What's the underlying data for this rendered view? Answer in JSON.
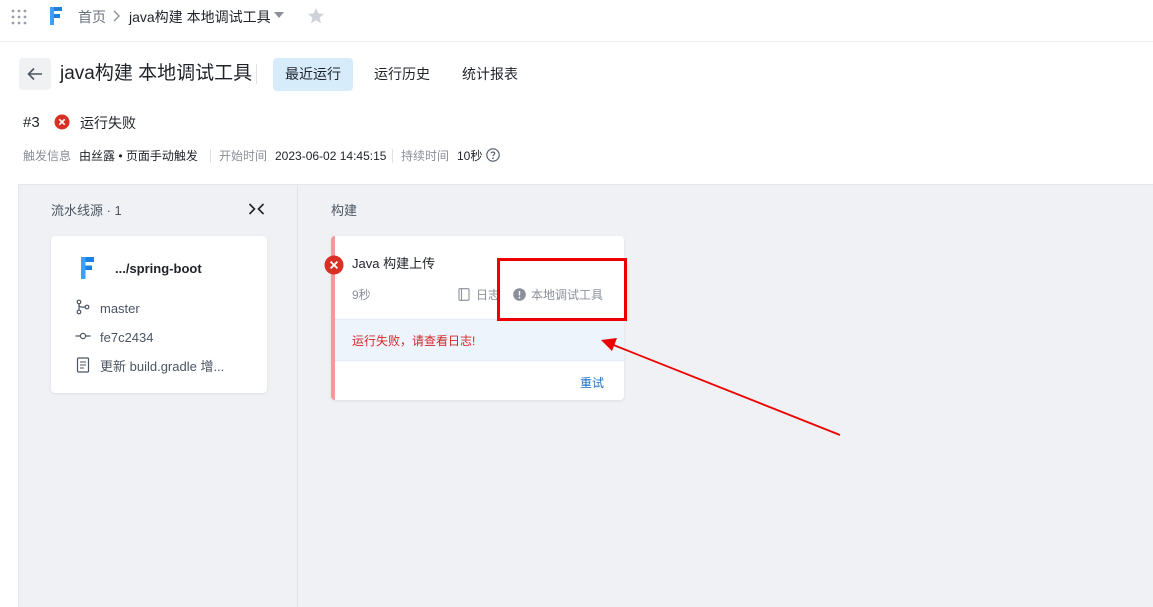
{
  "topbar": {
    "home": "首页",
    "current_pipeline": "java构建 本地调试工具"
  },
  "header": {
    "title": "java构建 本地调试工具",
    "tabs": [
      {
        "label": "最近运行",
        "active": true
      },
      {
        "label": "运行历史",
        "active": false
      },
      {
        "label": "统计报表",
        "active": false
      }
    ]
  },
  "run": {
    "number": "#3",
    "status": "运行失败",
    "trigger_label": "触发信息",
    "trigger_value": "由丝露 • 页面手动触发",
    "start_label": "开始时间",
    "start_value": "2023-06-02 14:45:15",
    "duration_label": "持续时间",
    "duration_value": "10秒"
  },
  "source": {
    "title": "流水线源 · 1",
    "repo": ".../spring-boot",
    "branch": "master",
    "commit": "fe7c2434",
    "message": "更新 build.gradle 增..."
  },
  "build": {
    "title": "构建",
    "job": {
      "name": "Java 构建上传",
      "duration": "9秒",
      "log_label": "日志",
      "tool_label": "本地调试工具",
      "error_text": "运行失败，请查看日志!",
      "retry_label": "重试"
    }
  },
  "colors": {
    "accent": "#1b73c7",
    "active_tab_bg": "#d6ecfb",
    "fail": "#d93026",
    "annotation": "#ee0000"
  },
  "icons": [
    "grid-icon",
    "logo-icon",
    "star-icon",
    "back-arrow-icon",
    "fail-icon",
    "help-icon",
    "collapse-icon",
    "branch-icon",
    "commit-icon",
    "file-icon",
    "log-icon",
    "info-icon"
  ]
}
